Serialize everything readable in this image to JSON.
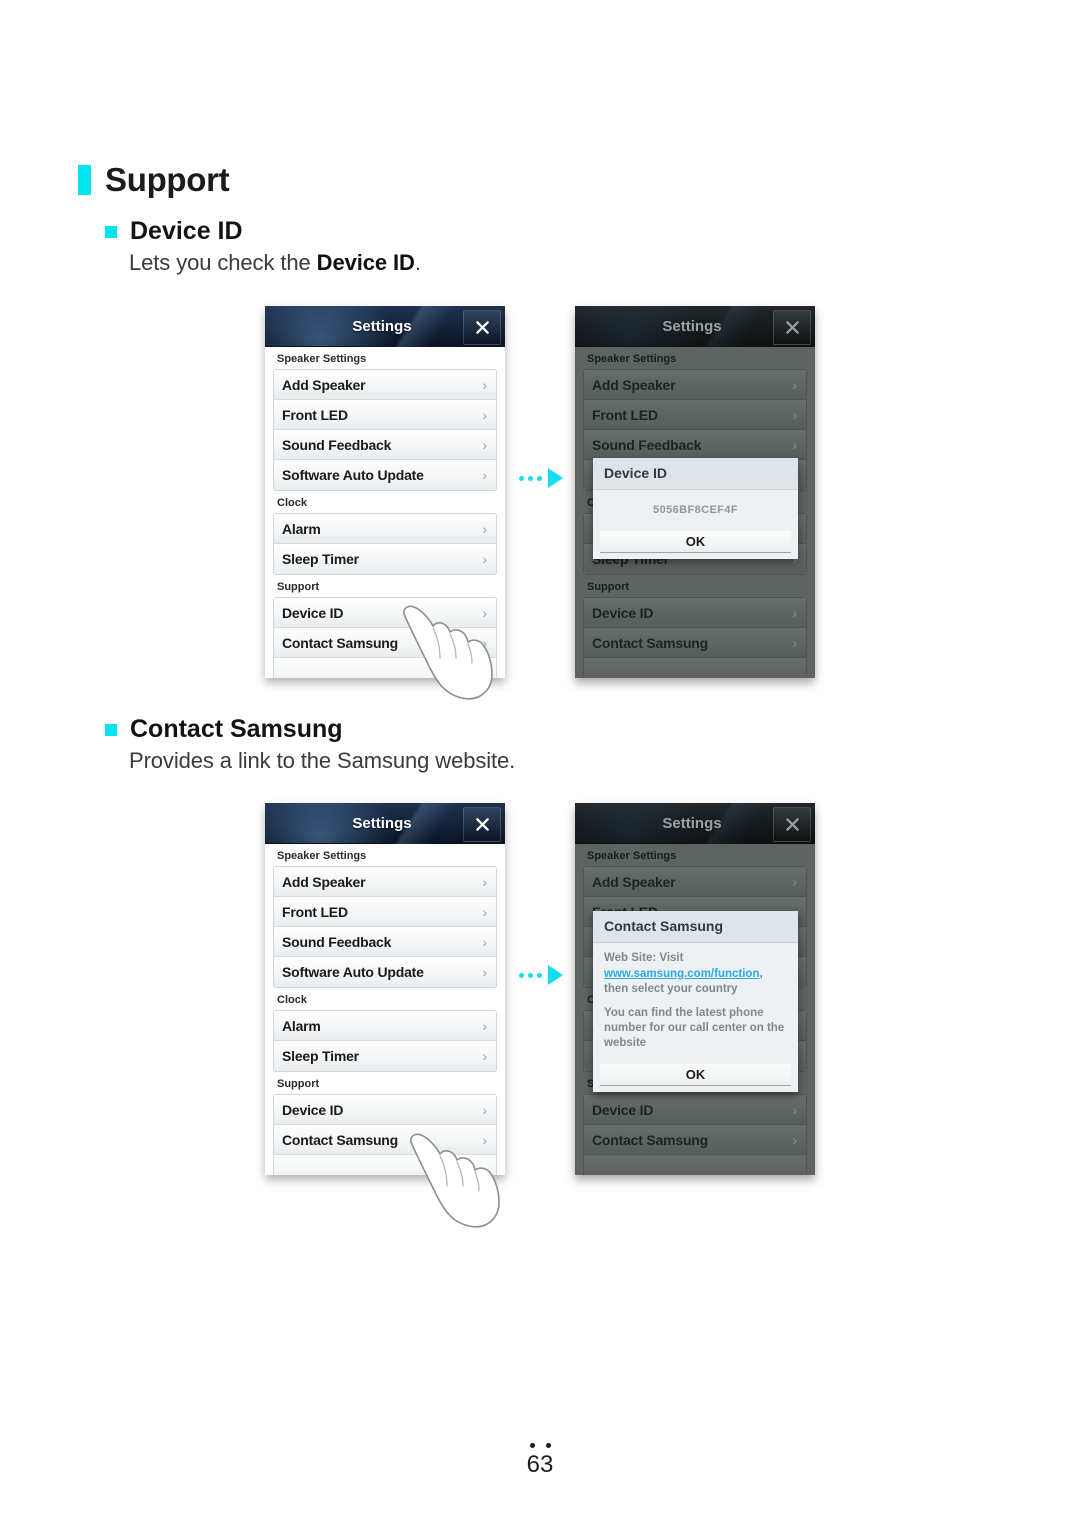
{
  "page": {
    "section_title": "Support",
    "page_number": "63",
    "footer_dot_count": 2
  },
  "topics": [
    {
      "heading": "Device ID",
      "description_prefix": "Lets you check the ",
      "description_bold": "Device ID",
      "description_suffix": "."
    },
    {
      "heading": "Contact Samsung",
      "description": "Provides a link to the Samsung website."
    }
  ],
  "settings_screen": {
    "title": "Settings",
    "close_icon": "close-icon",
    "chevron": "›",
    "sections": [
      {
        "label": "Speaker Settings",
        "items": [
          "Add Speaker",
          "Front LED",
          "Sound Feedback",
          "Software Auto Update"
        ]
      },
      {
        "label": "Clock",
        "items": [
          "Alarm",
          "Sleep Timer"
        ]
      },
      {
        "label": "Support",
        "items": [
          "Device ID",
          "Contact Samsung"
        ]
      }
    ]
  },
  "dialogs": {
    "device_id": {
      "title": "Device ID",
      "value": "5056BF8CEF4F",
      "ok_label": "OK"
    },
    "contact_samsung": {
      "title": "Contact Samsung",
      "line1_prefix": "Web Site: Visit",
      "link": "www.samsung.com/function",
      "line1_suffix": ",",
      "line2": "then select your country",
      "paragraph2": "You can find the latest phone number for our call center on the website",
      "ok_label": "OK"
    }
  },
  "arrow": {
    "name": "flow-arrow",
    "dots": 3,
    "color": "#16dcf0"
  },
  "colors": {
    "accent_cyan": "#00e5f0",
    "titlebar_dark": "#16263f",
    "dim_overlay": "#5d6462",
    "dialog_header": "#dde4ea",
    "link_blue": "#2aa8e8"
  }
}
